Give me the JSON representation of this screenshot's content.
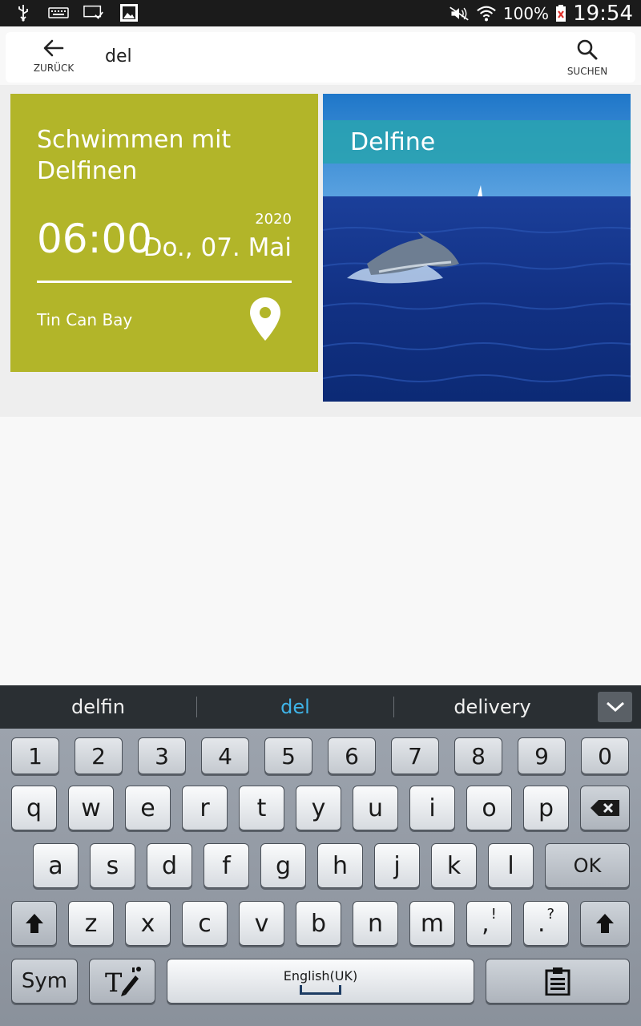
{
  "status_bar": {
    "battery_percent": "100%",
    "time": "19:54",
    "icons": [
      "usb-icon",
      "keyboard-icon",
      "screen-cast-icon",
      "gallery-icon",
      "mute-icon",
      "wifi-icon",
      "battery-icon"
    ]
  },
  "app_bar": {
    "back_label": "ZURÜCK",
    "search_query": "del",
    "search_label": "SUCHEN"
  },
  "event_card": {
    "title": "Schwimmen mit Delfinen",
    "time": "06:00",
    "year": "2020",
    "date": "Do., 07. Mai",
    "location": "Tin Can Bay",
    "background_color": "#b2b529"
  },
  "image_card": {
    "caption": "Delfine",
    "caption_color": "#29a3b0"
  },
  "keyboard": {
    "suggestions": [
      "delfin",
      "del",
      "delivery"
    ],
    "active_suggestion_color": "#3fb4e8",
    "row_numbers": [
      "1",
      "2",
      "3",
      "4",
      "5",
      "6",
      "7",
      "8",
      "9",
      "0"
    ],
    "row1": [
      "q",
      "w",
      "e",
      "r",
      "t",
      "y",
      "u",
      "i",
      "o",
      "p"
    ],
    "row2": [
      "a",
      "s",
      "d",
      "f",
      "g",
      "h",
      "j",
      "k",
      "l"
    ],
    "ok_label": "OK",
    "row3": [
      "z",
      "x",
      "c",
      "v",
      "b",
      "n",
      "m"
    ],
    "comma_key": ",",
    "comma_sub": "!",
    "period_key": ".",
    "period_sub": "?",
    "sym_label": "Sym",
    "space_label": "English(UK)"
  }
}
